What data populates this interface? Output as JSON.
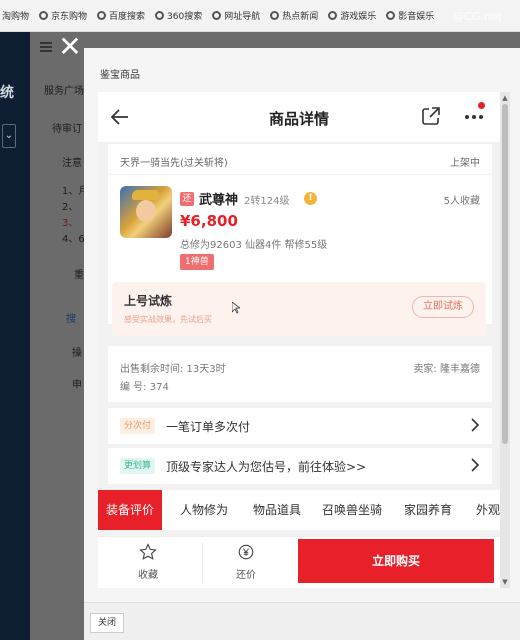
{
  "browser": {
    "bookmarks": [
      "淘购物",
      "京东购物",
      "百度搜索",
      "360搜索",
      "网址导航",
      "热点新闻",
      "游戏娱乐",
      "影音娱乐"
    ],
    "watermark": "@CG.net"
  },
  "background_app": {
    "left_title": "统",
    "texts": [
      "服务广场",
      "待审订",
      "注意",
      "1、月",
      "2、",
      "3、",
      "4、6",
      "重",
      "搜",
      "操",
      "申"
    ]
  },
  "modal": {
    "title": "鉴宝商品",
    "close_label": "关闭"
  },
  "product": {
    "nav_title": "商品详情",
    "server": "天界一骑当先(过关斩将)",
    "status": "上架中",
    "tag_huan": "还",
    "character_name": "武尊神",
    "level_info": "2转124级",
    "favorites": "5人收藏",
    "price": "¥6,800",
    "stats": "总修为92603  仙器4件  帮修55级",
    "beast_tag": "1神兽",
    "trial": {
      "title": "上号试炼",
      "subtitle": "感受实战效果，先试后买",
      "button": "立即试炼"
    },
    "sale_time": "出售剩余时间: 13天3时",
    "seller": "卖家: 隆丰嘉德",
    "serial": "编 号: 374",
    "installment": {
      "tag": "分次付",
      "text": "一笔订单多次付"
    },
    "estimate": {
      "tag": "更划算",
      "text": "顶级专家达人为您估号，前往体验>>"
    },
    "tabs": [
      "装备评价",
      "人物修为",
      "物品道具",
      "召唤兽坐骑",
      "家园养育",
      "外观"
    ],
    "actions": {
      "favorite": "收藏",
      "bargain": "还价",
      "buy": "立即购买"
    }
  },
  "colors": {
    "accent": "#e8202a",
    "tag_red": "#ef6e6e",
    "overlay_dark": "#0f1e33"
  }
}
